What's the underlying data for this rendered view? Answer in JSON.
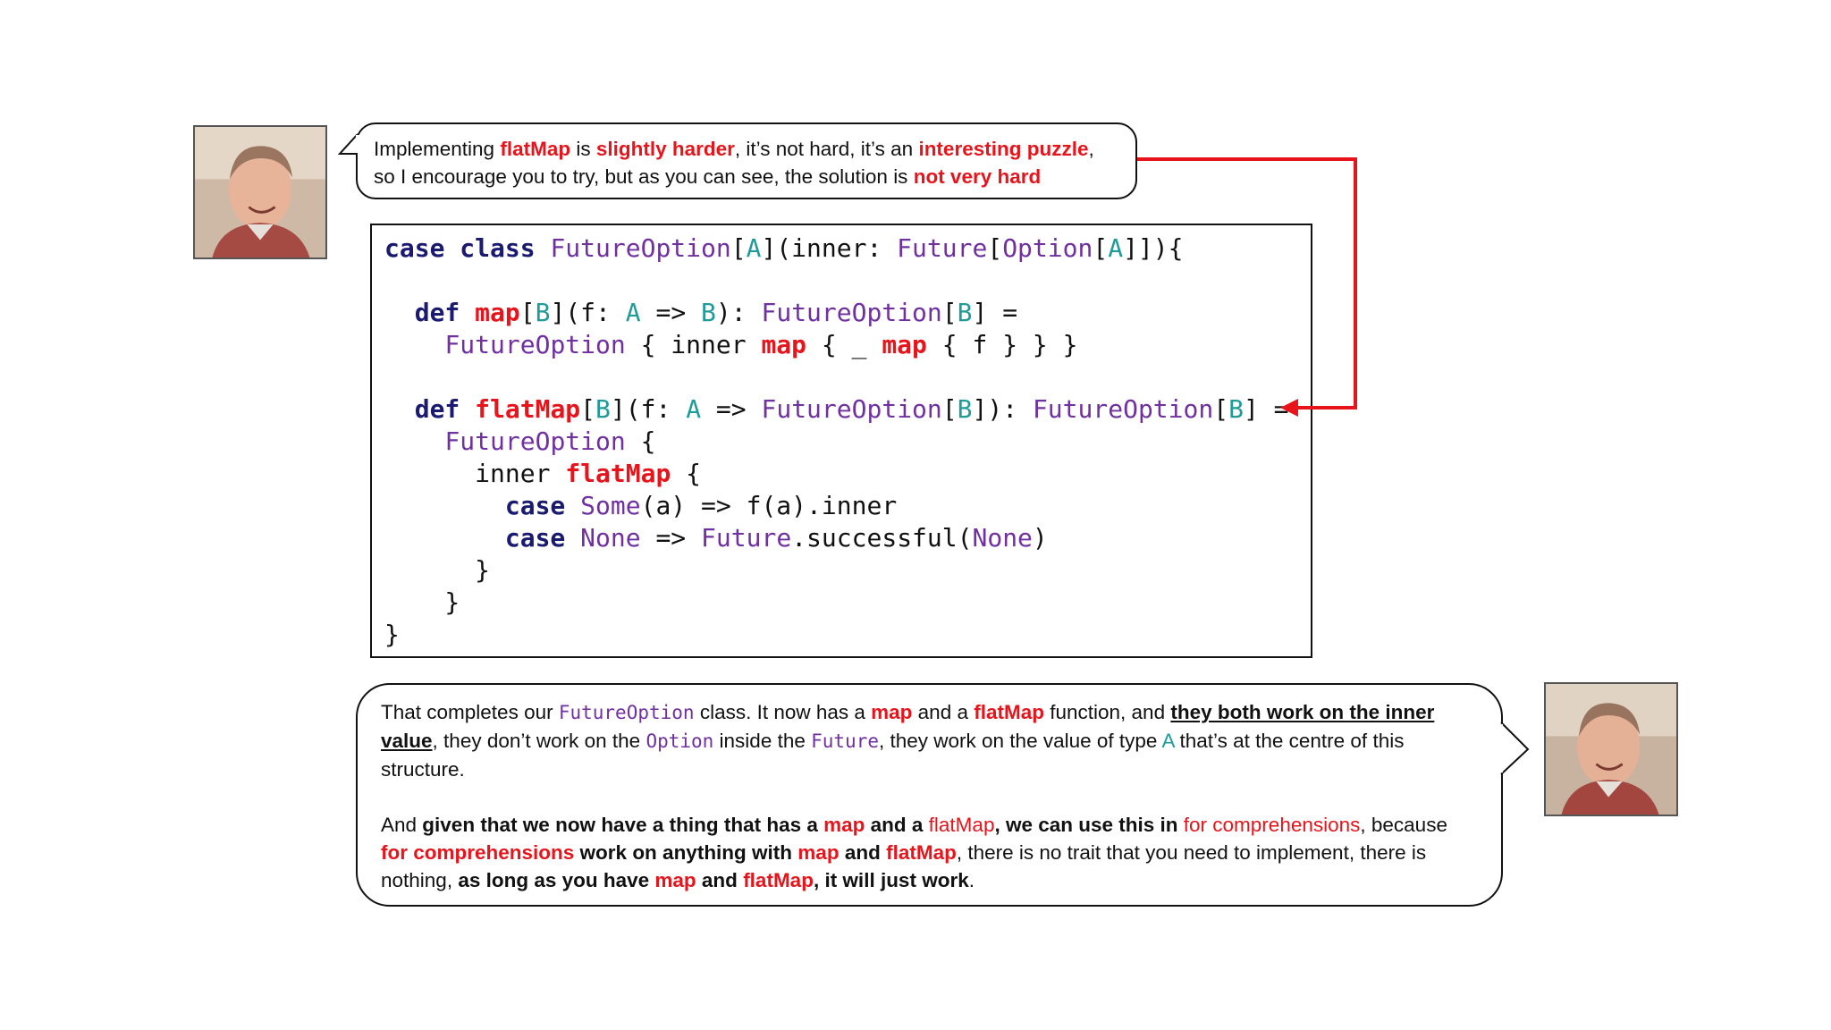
{
  "top_bubble": {
    "segments": [
      {
        "text": "Implementing ",
        "style": "plain"
      },
      {
        "text": "flatMap",
        "style": "red"
      },
      {
        "text": " is ",
        "style": "plain"
      },
      {
        "text": "slightly harder",
        "style": "red"
      },
      {
        "text": ", it’s not hard, it’s an ",
        "style": "plain"
      },
      {
        "text": "interesting puzzle",
        "style": "red"
      },
      {
        "text": ",",
        "style": "plain"
      },
      {
        "text": "\n",
        "style": "br"
      },
      {
        "text": "so I encourage you to try, but as you can see, the solution is ",
        "style": "plain"
      },
      {
        "text": "not very hard",
        "style": "red"
      }
    ]
  },
  "code": {
    "lines": [
      [
        [
          "k",
          "case class "
        ],
        [
          "t",
          "FutureOption"
        ],
        [
          "p",
          "["
        ],
        [
          "g",
          "A"
        ],
        [
          "p",
          "](inner: "
        ],
        [
          "t",
          "Future"
        ],
        [
          "p",
          "["
        ],
        [
          "t",
          "Option"
        ],
        [
          "p",
          "["
        ],
        [
          "g",
          "A"
        ],
        [
          "p",
          "]]){"
        ]
      ],
      [],
      [
        [
          "p",
          "  "
        ],
        [
          "k",
          "def "
        ],
        [
          "m",
          "map"
        ],
        [
          "p",
          "["
        ],
        [
          "g",
          "B"
        ],
        [
          "p",
          "](f: "
        ],
        [
          "g",
          "A"
        ],
        [
          "p",
          " => "
        ],
        [
          "g",
          "B"
        ],
        [
          "p",
          "): "
        ],
        [
          "t",
          "FutureOption"
        ],
        [
          "p",
          "["
        ],
        [
          "g",
          "B"
        ],
        [
          "p",
          "] ="
        ]
      ],
      [
        [
          "p",
          "    "
        ],
        [
          "t",
          "FutureOption"
        ],
        [
          "p",
          " { inner "
        ],
        [
          "m",
          "map"
        ],
        [
          "p",
          " { _ "
        ],
        [
          "m",
          "map"
        ],
        [
          "p",
          " { f } } }"
        ]
      ],
      [],
      [
        [
          "p",
          "  "
        ],
        [
          "k",
          "def "
        ],
        [
          "m",
          "flatMap"
        ],
        [
          "p",
          "["
        ],
        [
          "g",
          "B"
        ],
        [
          "p",
          "](f: "
        ],
        [
          "g",
          "A"
        ],
        [
          "p",
          " => "
        ],
        [
          "t",
          "FutureOption"
        ],
        [
          "p",
          "["
        ],
        [
          "g",
          "B"
        ],
        [
          "p",
          "]): "
        ],
        [
          "t",
          "FutureOption"
        ],
        [
          "p",
          "["
        ],
        [
          "g",
          "B"
        ],
        [
          "p",
          "] ="
        ]
      ],
      [
        [
          "p",
          "    "
        ],
        [
          "t",
          "FutureOption"
        ],
        [
          "p",
          " {"
        ]
      ],
      [
        [
          "p",
          "      inner "
        ],
        [
          "m",
          "flatMap"
        ],
        [
          "p",
          " {"
        ]
      ],
      [
        [
          "p",
          "        "
        ],
        [
          "k",
          "case "
        ],
        [
          "t",
          "Some"
        ],
        [
          "p",
          "(a) => f(a).inner"
        ]
      ],
      [
        [
          "p",
          "        "
        ],
        [
          "k",
          "case "
        ],
        [
          "t",
          "None"
        ],
        [
          "p",
          " => "
        ],
        [
          "t",
          "Future"
        ],
        [
          "p",
          ".successful("
        ],
        [
          "t",
          "None"
        ],
        [
          "p",
          ")"
        ]
      ],
      [
        [
          "p",
          "      }"
        ]
      ],
      [
        [
          "p",
          "    }"
        ]
      ],
      [
        [
          "p",
          "}"
        ]
      ]
    ]
  },
  "bottom_bubble": {
    "paragraphs": [
      [
        {
          "text": "That completes our ",
          "style": "plain"
        },
        {
          "text": "FutureOption",
          "style": "purple"
        },
        {
          "text": "  class. It now has a ",
          "style": "plain"
        },
        {
          "text": "map",
          "style": "red"
        },
        {
          "text": " and a ",
          "style": "plain"
        },
        {
          "text": "flatMap",
          "style": "red"
        },
        {
          "text": " function, and ",
          "style": "plain"
        },
        {
          "text": "they both work on the inner value",
          "style": "ul"
        },
        {
          "text": ", they don’t work on the ",
          "style": "plain"
        },
        {
          "text": "Option",
          "style": "purple"
        },
        {
          "text": " inside the ",
          "style": "plain"
        },
        {
          "text": "Future",
          "style": "purple"
        },
        {
          "text": ", they work on the value of type ",
          "style": "plain"
        },
        {
          "text": "A",
          "style": "teal"
        },
        {
          "text": " that’s at the centre of this structure.",
          "style": "plain"
        }
      ],
      [
        {
          "text": "And ",
          "style": "plain"
        },
        {
          "text": "given that we now have a thing that has a ",
          "style": "bold"
        },
        {
          "text": "map",
          "style": "red"
        },
        {
          "text": " and a ",
          "style": "bold"
        },
        {
          "text": "flatMap",
          "style": "redn"
        },
        {
          "text": ", we can use this in ",
          "style": "bold"
        },
        {
          "text": "for comprehensions",
          "style": "redn"
        },
        {
          "text": ", because ",
          "style": "plain"
        },
        {
          "text": "for comprehensions",
          "style": "red"
        },
        {
          "text": " work on anything with ",
          "style": "bold"
        },
        {
          "text": "map",
          "style": "red"
        },
        {
          "text": " and ",
          "style": "bold"
        },
        {
          "text": "flatMap",
          "style": "red"
        },
        {
          "text": ", there is no trait that you need to implement, there is nothing, ",
          "style": "plain"
        },
        {
          "text": "as long as you have ",
          "style": "bold"
        },
        {
          "text": "map",
          "style": "red"
        },
        {
          "text": " and ",
          "style": "bold"
        },
        {
          "text": "flatMap",
          "style": "red"
        },
        {
          "text": ", it will just work",
          "style": "bold"
        },
        {
          "text": ".",
          "style": "plain"
        }
      ]
    ]
  },
  "colors": {
    "keyword": "#1a1a70",
    "type": "#7030a0",
    "type_param": "#219a9a",
    "highlight": "#e8141b",
    "arrow": "#e8141b"
  },
  "icons": [
    "speaker-photo-top",
    "speaker-photo-bottom",
    "arrow-connector"
  ]
}
